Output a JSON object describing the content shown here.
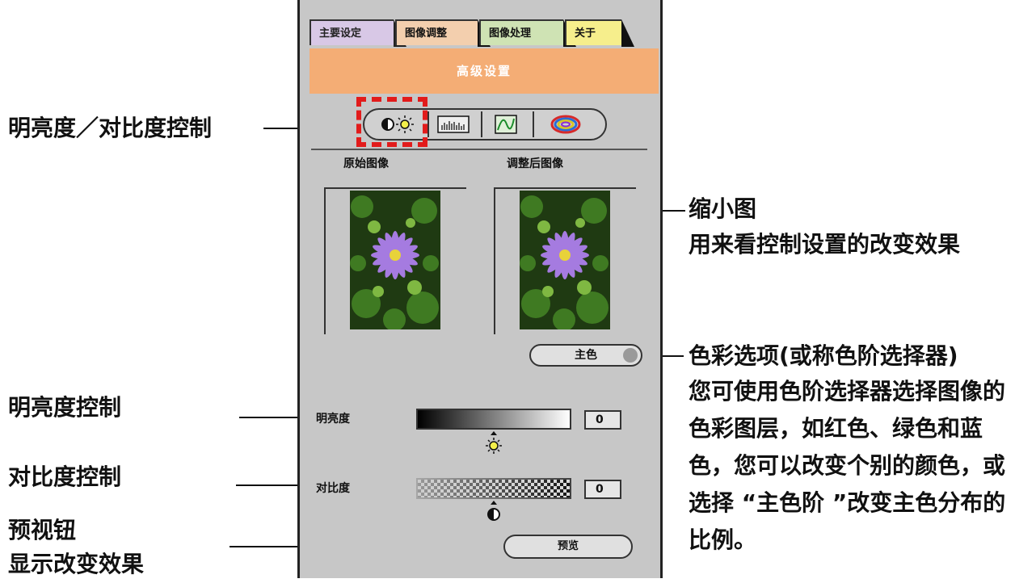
{
  "annotations": {
    "brightness_contrast_control": "明亮度／对比度控制",
    "thumbnail_title": "缩小图",
    "thumbnail_desc": "用来看控制设置的改变效果",
    "color_option_title": "色彩选项(或称色阶选择器)",
    "color_option_desc_1": "您可使用色阶选择器选择图像的",
    "color_option_desc_2": "色彩图层，如红色、绿色和蓝",
    "color_option_desc_3": "色，您可以改变个别的颜色，或",
    "color_option_desc_4": "选择 “主色阶 ”改变主色分布的",
    "color_option_desc_5": "比例。",
    "brightness_control": "明亮度控制",
    "contrast_control": "对比度控制",
    "preview_button_title": "预视钮",
    "preview_button_desc": "显示改变效果"
  },
  "dialog": {
    "tabs": [
      "主要设定",
      "图像调整",
      "图像处理",
      "关于"
    ],
    "banner": "高级设置",
    "tools": [
      {
        "icon": "brightness-contrast-icon"
      },
      {
        "icon": "histogram-icon"
      },
      {
        "icon": "curve-icon"
      },
      {
        "icon": "color-wheel-icon"
      }
    ],
    "original_label": "原始图像",
    "adjusted_label": "调整后图像",
    "channel_select": "主色",
    "brightness_label": "明亮度",
    "brightness_value": "0",
    "contrast_label": "对比度",
    "contrast_value": "0",
    "preview_label": "预览"
  },
  "colors": {
    "banner": "#f4ad75",
    "selection_highlight": "#e21b1b",
    "panel": "#c7c7c7"
  }
}
